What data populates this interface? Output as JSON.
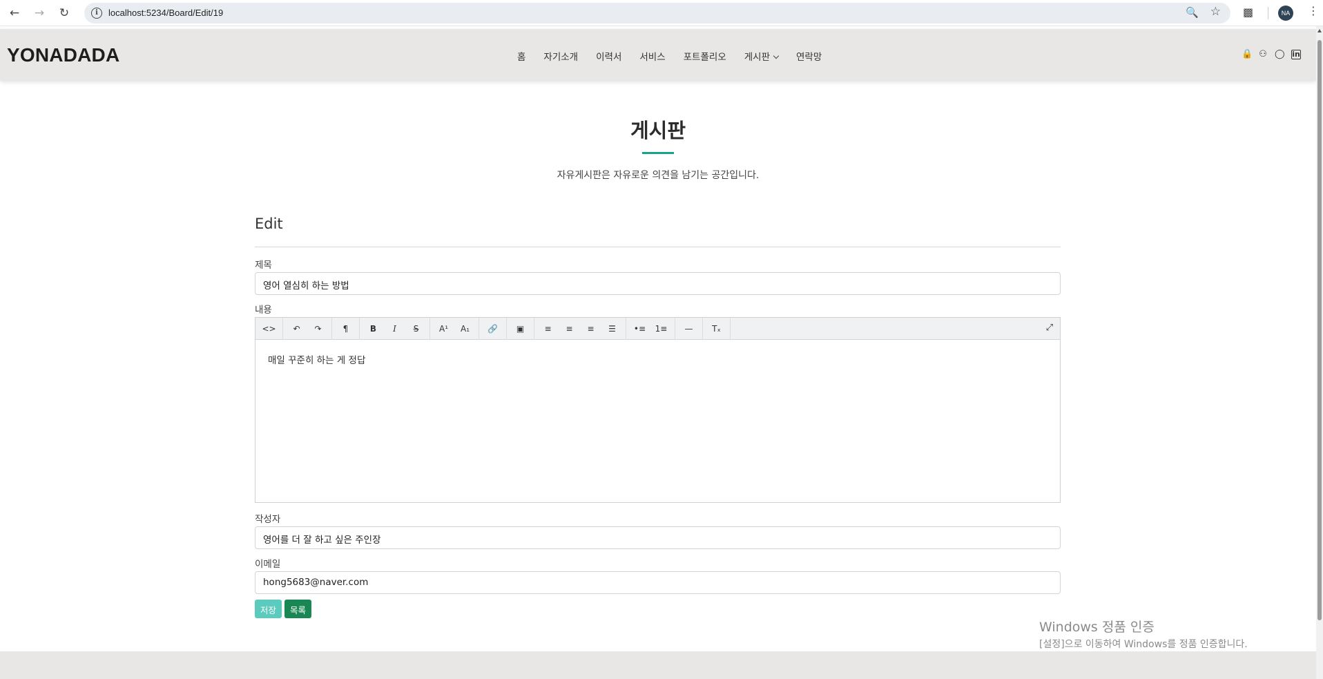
{
  "browser": {
    "url": "localhost:5234/Board/Edit/19",
    "profile_initials": "NA"
  },
  "site": {
    "logo": "YONADADA",
    "nav": [
      "홈",
      "자기소개",
      "이력서",
      "서비스",
      "포트폴리오",
      "게시판",
      "연락망"
    ]
  },
  "section": {
    "title": "게시판",
    "subtitle": "자유게시판은 자유로운 의견을 남기는 공간입니다."
  },
  "form": {
    "heading": "Edit",
    "title_label": "제목",
    "title_value": "영어 열심히 하는 방법",
    "content_label": "내용",
    "content_value": "매일 꾸준히 하는 게 정답",
    "author_label": "작성자",
    "author_value": "영어를 더 잘 하고 싶은 주인장",
    "email_label": "이메일",
    "email_value": "hong5683@naver.com",
    "save_label": "저장",
    "list_label": "목록"
  },
  "watermark": {
    "line1": "Windows 정품 인증",
    "line2": "[설정]으로 이동하여 Windows를 정품 인증합니다."
  }
}
